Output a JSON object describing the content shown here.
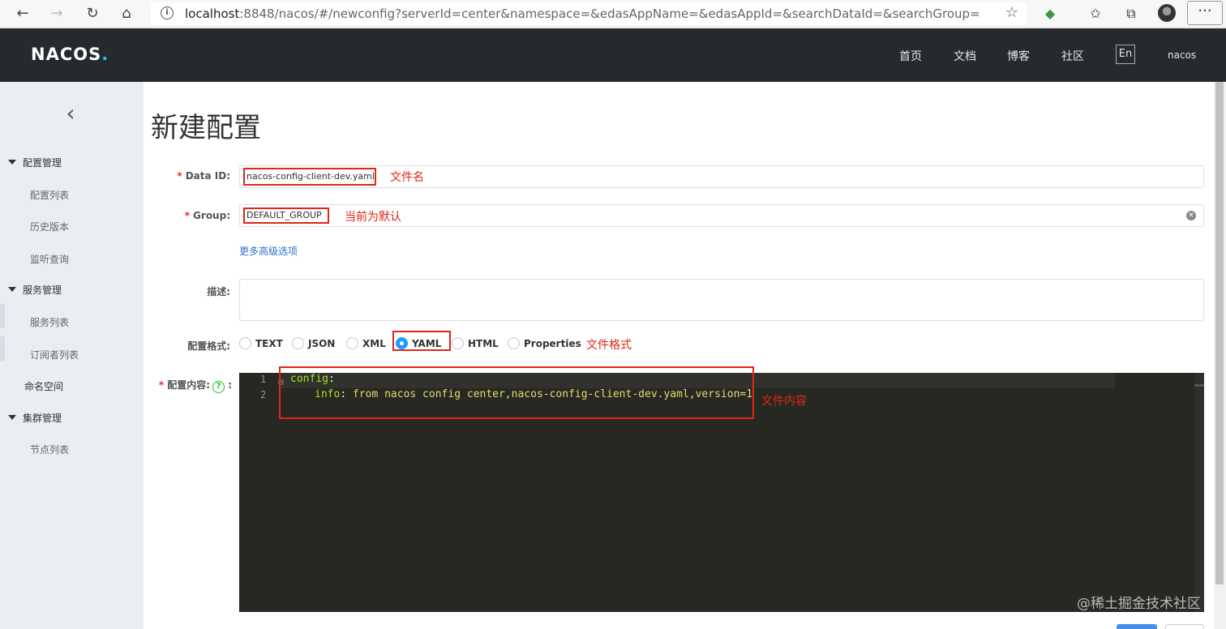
{
  "browser": {
    "url_prefix": "localhost",
    "url_rest": ":8848/nacos/#/newconfig?serverId=center&namespace=&edasAppName=&edasAppId=&searchDataId=&searchGroup="
  },
  "header": {
    "logo": "NACOS",
    "nav": [
      "首页",
      "文档",
      "博客",
      "社区"
    ],
    "lang": "En",
    "user": "nacos"
  },
  "sidebar": {
    "groups": [
      {
        "label": "配置管理",
        "items": [
          "配置列表",
          "历史版本",
          "监听查询"
        ]
      },
      {
        "label": "服务管理",
        "items": [
          "服务列表",
          "订阅者列表"
        ]
      },
      {
        "label": "命名空间"
      },
      {
        "label": "集群管理",
        "items": [
          "节点列表"
        ]
      }
    ]
  },
  "page": {
    "title": "新建配置",
    "data_id_label": "Data ID:",
    "data_id_value": "nacos-config-client-dev.yaml",
    "group_label": "Group:",
    "group_value": "DEFAULT_GROUP",
    "advanced_link": "更多高级选项",
    "desc_label": "描述:",
    "format_label": "配置格式:",
    "formats": [
      "TEXT",
      "JSON",
      "XML",
      "YAML",
      "HTML",
      "Properties"
    ],
    "selected_format": "YAML",
    "content_label": "配置内容:",
    "content_suffix": ":",
    "code": {
      "line1_key": "config",
      "line1_punct": ":",
      "line2_key": "info",
      "line2_punct": ":",
      "line2_value": " from nacos config center,nacos-config-client-dev.yaml,version=1"
    }
  },
  "annotations": {
    "file_name": "文件名",
    "group_default": "当前为默认",
    "file_format": "文件格式",
    "file_content": "文件内容"
  },
  "watermark": "@稀土掘金技术社区",
  "colors": {
    "accent": "#209bfa",
    "annotation": "#e1251b",
    "header_bg": "#252a2f"
  }
}
